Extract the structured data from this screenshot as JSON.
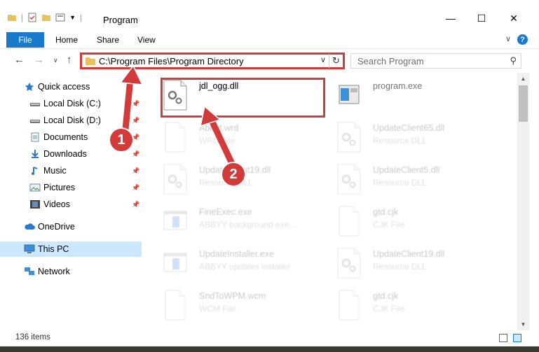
{
  "window": {
    "title": "Program",
    "controls": {
      "minimize": "—",
      "maximize": "☐",
      "close": "✕"
    }
  },
  "ribbon": {
    "tabs": [
      "File",
      "Home",
      "Share",
      "View"
    ],
    "help": "?"
  },
  "address": {
    "path": "C:\\Program Files\\Program Directory"
  },
  "search": {
    "placeholder": "Search Program"
  },
  "sidebar": {
    "items": [
      {
        "label": "Quick access",
        "icon": "star-icon",
        "pinned": false
      },
      {
        "label": "Local Disk (C:)",
        "icon": "drive-icon",
        "pinned": true
      },
      {
        "label": "Local Disk (D:)",
        "icon": "drive-icon",
        "pinned": true
      },
      {
        "label": "Documents",
        "icon": "documents-icon",
        "pinned": true
      },
      {
        "label": "Downloads",
        "icon": "download-icon",
        "pinned": true
      },
      {
        "label": "Music",
        "icon": "music-icon",
        "pinned": true
      },
      {
        "label": "Pictures",
        "icon": "pictures-icon",
        "pinned": true
      },
      {
        "label": "Videos",
        "icon": "videos-icon",
        "pinned": true
      },
      {
        "label": "OneDrive",
        "icon": "cloud-icon",
        "pinned": false
      },
      {
        "label": "This PC",
        "icon": "computer-icon",
        "pinned": false,
        "selected": true
      },
      {
        "label": "Network",
        "icon": "network-icon",
        "pinned": false
      }
    ]
  },
  "files": [
    {
      "name": "jdl_ogg.dll",
      "type": "",
      "kind": "dll",
      "highlighted": true
    },
    {
      "name": "program.exe",
      "type": "",
      "kind": "exe"
    },
    {
      "name": "About.wrd",
      "type": "WRD File",
      "kind": "doc"
    },
    {
      "name": "UpdateClient65.dll",
      "type": "Resource DLL",
      "kind": "dll"
    },
    {
      "name": "UpdateClient19.dll",
      "type": "Resource DLL",
      "kind": "dll"
    },
    {
      "name": "UpdateClient5.dll",
      "type": "Resource DLL",
      "kind": "dll"
    },
    {
      "name": "FineExec.exe",
      "type": "ABBYY background exe...",
      "kind": "app"
    },
    {
      "name": "gtd.cjk",
      "type": "CJK File",
      "kind": "doc"
    },
    {
      "name": "UpdateInstaller.exe",
      "type": "ABBYY updates installer",
      "kind": "app"
    },
    {
      "name": "UpdateClient19.dll",
      "type": "Resource DLL",
      "kind": "dll"
    },
    {
      "name": "SndToWPM.wcm",
      "type": "WCM File",
      "kind": "doc"
    },
    {
      "name": "gtd.cjk",
      "type": "CJK File",
      "kind": "doc"
    }
  ],
  "status": {
    "count": "136 items"
  },
  "annotations": {
    "step1": "1",
    "step2": "2"
  },
  "colors": {
    "accent": "#1979ca",
    "highlight": "#d33b3b",
    "selection": "#cce8ff"
  }
}
